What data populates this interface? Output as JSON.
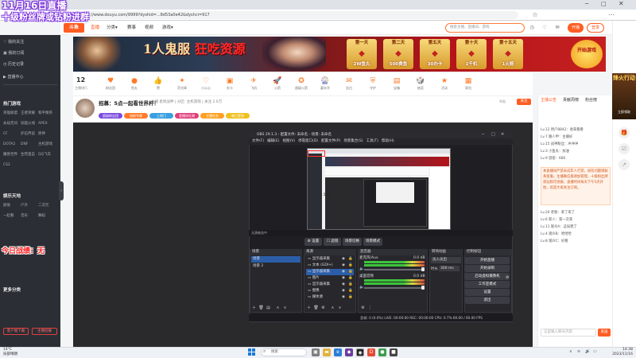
{
  "overlay": {
    "title": "11月16日直播",
    "subtitle": "十级粉丝牌或钻粉进群",
    "topic": "今日战绩：无"
  },
  "browser": {
    "url": "https://www.douyu.com/9999?dyshid=...8d53a0e42&dyshci=917"
  },
  "site": {
    "logo": "斗鱼",
    "nav": [
      "直播",
      "分类▾",
      "赛事",
      "视频",
      "游戏▾"
    ],
    "search_placeholder": "搜索主播、直播间、游戏",
    "open_live": "开播",
    "login": "登录"
  },
  "sidebar": {
    "items": [
      "我的关注",
      "我的订阅",
      "历史记录",
      "直播中心"
    ],
    "section_hot": "热门游戏",
    "hot_games": [
      "英雄联盟",
      "王者荣耀",
      "和平精英",
      "永劫无间",
      "穿越火线",
      "APEX",
      "CF",
      "炉石传说",
      "原神",
      "DOTA2",
      "DNF",
      "主机游戏",
      "魔兽世界",
      "生死狙击",
      "QQ飞车",
      "CS2"
    ],
    "section_ent": "娱乐天地",
    "ent": [
      "颜值",
      "户外",
      "二次元",
      "一起看",
      "音乐",
      "舞蹈"
    ],
    "section_more": "更多分类",
    "buttons": [
      "客户端下载",
      "主播招募"
    ]
  },
  "banner": {
    "headline_a": "1人鬼服",
    "headline_b": "狂吃资源",
    "days": [
      {
        "label": "第一天",
        "prize": "2W鱼丸"
      },
      {
        "label": "第二天",
        "prize": "500费鱼"
      },
      {
        "label": "第五天",
        "prize": "30办卡"
      },
      {
        "label": "第十天",
        "prize": "1千机"
      },
      {
        "label": "第十五天",
        "prize": "1火箭"
      }
    ],
    "cta": "开始游戏"
  },
  "room": {
    "rank_num": "12",
    "rank_label": "主播排行",
    "gifts": [
      "粉丝团",
      "鱼丸",
      "赞",
      "荧光棒",
      "小心心",
      "办卡",
      "飞机",
      "火箭",
      "超级火箭",
      "嘉年华",
      "告白",
      "守护",
      "宝箱",
      "抽奖",
      "活动",
      "背包"
    ],
    "title": "招募：5点一起看世界杯！",
    "meta": "主播  星际战神  | 分区: 主机游戏  | 关注 2.6万",
    "tags": [
      "超级粉丝团",
      "钻粉专属",
      "上热门",
      "直播间礼物",
      "主播任务",
      "每日签到"
    ],
    "report": "举报",
    "follow": "关注"
  },
  "obs": {
    "title": "OBS 29.1.3 - 配置文件: 未命名 - 场景: 未命名",
    "menu": [
      "文件(F)",
      "编辑(E)",
      "视图(V)",
      "停靠窗口(D)",
      "配置文件(P)",
      "场景集合(S)",
      "工具(T)",
      "帮助(H)"
    ],
    "source_bar": "无源被选中",
    "toolbar": [
      "⚙ 设置",
      "☐ 滤镜",
      "场景切换",
      "场景模式"
    ],
    "scenes_title": "场景",
    "scenes": [
      "场景",
      "场景 2"
    ],
    "sources_title": "来源",
    "sources": [
      "显示器采集",
      "文本 (GDI+)",
      "显示器采集",
      "图片",
      "显示器采集",
      "图像",
      "媒体源"
    ],
    "mixer_title": "混音器",
    "mixer": [
      {
        "name": "桌面音频",
        "db": "0.0 dB"
      },
      {
        "name": "麦克风/Aux",
        "db": "0.0 dB"
      }
    ],
    "transitions_title": "转场动画",
    "transition": "淡入淡出",
    "duration_label": "时长",
    "duration": "300 ms",
    "controls_title": "控制按钮",
    "controls": [
      "开始直播",
      "开始录制",
      "启动虚拟摄像机",
      "工作室模式",
      "设置",
      "退出"
    ],
    "status": "丢帧: 0 (0.0%)   LIVE: 00:00:00   REC: 00:00:00   CPU: 0.7%  60.00 / 60.00 FPS"
  },
  "chat": {
    "tabs": [
      "主播公告",
      "贡献周榜",
      "粉丝榜"
    ],
    "lines": [
      "Lv.12  用户8842：进来看看",
      "Lv.7  路人甲：主播好",
      "Lv.15  战神粉丝：冲冲冲",
      "Lv.3  小鱼丸：加油",
      "Lv.9  游客：666"
    ],
    "notice": "本直播间严禁未成年人打赏，如有问题请联系客服。主播微信群请加管理，十级粉丝牌或钻粉可进群，直播时间每天下午5点开始，欢迎大家关注订阅。",
    "more_lines": [
      "Lv.20  老粉：来了来了",
      "Lv.6  新人：第一次来",
      "Lv.11  观众A：这局稳了",
      "Lv.4  观众B：哈哈哈",
      "Lv.8  观众C：好看"
    ],
    "input_placeholder": "这里输入聊天内容",
    "send": "发送"
  },
  "promo": {
    "title": "烽火行动",
    "sub": "立即领取"
  },
  "taskbar": {
    "weather_temp": "14°C",
    "weather_desc": "局部晴朗",
    "search": "搜索",
    "time": "14:38",
    "date": "2023/11/16"
  }
}
